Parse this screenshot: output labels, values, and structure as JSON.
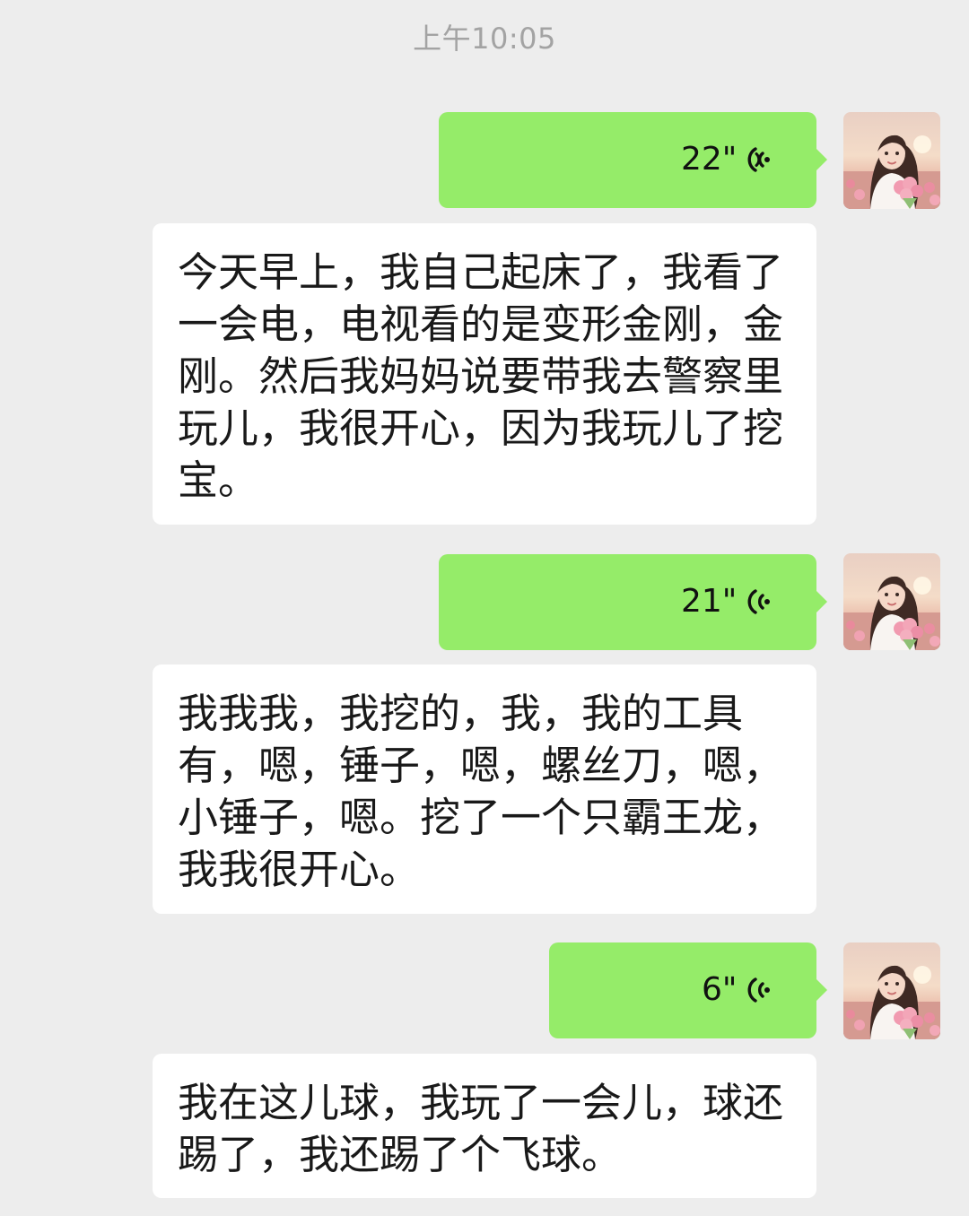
{
  "timestamp": "上午10:05",
  "messages": [
    {
      "type": "voice",
      "duration": "22\"",
      "sender": "me"
    },
    {
      "type": "text",
      "text": "今天早上，我自己起床了，我看了一会电，电视看的是变形金刚，金刚。然后我妈妈说要带我去警察里玩儿，我很开心，因为我玩儿了挖宝。"
    },
    {
      "type": "voice",
      "duration": "21\"",
      "sender": "me"
    },
    {
      "type": "text",
      "text": "我我我，我挖的，我，我的工具有，嗯，锤子，嗯，螺丝刀，嗯，小锤子，嗯。挖了一个只霸王龙，我我很开心。"
    },
    {
      "type": "voice",
      "duration": "6\"",
      "sender": "me"
    },
    {
      "type": "text",
      "text": "我在这儿球，我玩了一会儿，球还踢了，我还踢了个飞球。"
    }
  ],
  "colors": {
    "background": "#ededed",
    "voice_bubble": "#95ec69",
    "text_bubble": "#ffffff",
    "timestamp": "#a3a3a3"
  },
  "icons": {
    "voice": "voice-wave-icon",
    "avatar": "user-avatar"
  }
}
